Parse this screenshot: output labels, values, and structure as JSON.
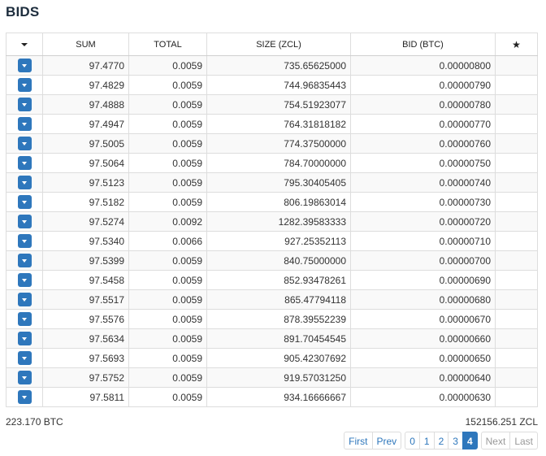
{
  "title": "BIDS",
  "columns": {
    "sum": "SUM",
    "total": "TOTAL",
    "size": "SIZE (ZCL)",
    "bid": "BID (BTC)",
    "star": "★"
  },
  "rows": [
    {
      "sum": "97.4770",
      "total": "0.0059",
      "size": "735.65625000",
      "bid": "0.00000800"
    },
    {
      "sum": "97.4829",
      "total": "0.0059",
      "size": "744.96835443",
      "bid": "0.00000790"
    },
    {
      "sum": "97.4888",
      "total": "0.0059",
      "size": "754.51923077",
      "bid": "0.00000780"
    },
    {
      "sum": "97.4947",
      "total": "0.0059",
      "size": "764.31818182",
      "bid": "0.00000770"
    },
    {
      "sum": "97.5005",
      "total": "0.0059",
      "size": "774.37500000",
      "bid": "0.00000760"
    },
    {
      "sum": "97.5064",
      "total": "0.0059",
      "size": "784.70000000",
      "bid": "0.00000750"
    },
    {
      "sum": "97.5123",
      "total": "0.0059",
      "size": "795.30405405",
      "bid": "0.00000740"
    },
    {
      "sum": "97.5182",
      "total": "0.0059",
      "size": "806.19863014",
      "bid": "0.00000730"
    },
    {
      "sum": "97.5274",
      "total": "0.0092",
      "size": "1282.39583333",
      "bid": "0.00000720"
    },
    {
      "sum": "97.5340",
      "total": "0.0066",
      "size": "927.25352113",
      "bid": "0.00000710"
    },
    {
      "sum": "97.5399",
      "total": "0.0059",
      "size": "840.75000000",
      "bid": "0.00000700"
    },
    {
      "sum": "97.5458",
      "total": "0.0059",
      "size": "852.93478261",
      "bid": "0.00000690"
    },
    {
      "sum": "97.5517",
      "total": "0.0059",
      "size": "865.47794118",
      "bid": "0.00000680"
    },
    {
      "sum": "97.5576",
      "total": "0.0059",
      "size": "878.39552239",
      "bid": "0.00000670"
    },
    {
      "sum": "97.5634",
      "total": "0.0059",
      "size": "891.70454545",
      "bid": "0.00000660"
    },
    {
      "sum": "97.5693",
      "total": "0.0059",
      "size": "905.42307692",
      "bid": "0.00000650"
    },
    {
      "sum": "97.5752",
      "total": "0.0059",
      "size": "919.57031250",
      "bid": "0.00000640"
    },
    {
      "sum": "97.5811",
      "total": "0.0059",
      "size": "934.16666667",
      "bid": "0.00000630"
    }
  ],
  "footer": {
    "total_btc": "223.170 BTC",
    "total_zcl": "152156.251 ZCL"
  },
  "pagination": {
    "first": "First",
    "prev": "Prev",
    "pages": [
      "0",
      "1",
      "2",
      "3",
      "4"
    ],
    "active_page": "4",
    "next": "Next",
    "last": "Last"
  },
  "colors": {
    "accent": "#2e77bc",
    "title": "#1d2d3d"
  },
  "icons": {
    "row_action": "caret-down-icon",
    "header_sort": "caret-down-icon",
    "favorite": "star-icon"
  }
}
